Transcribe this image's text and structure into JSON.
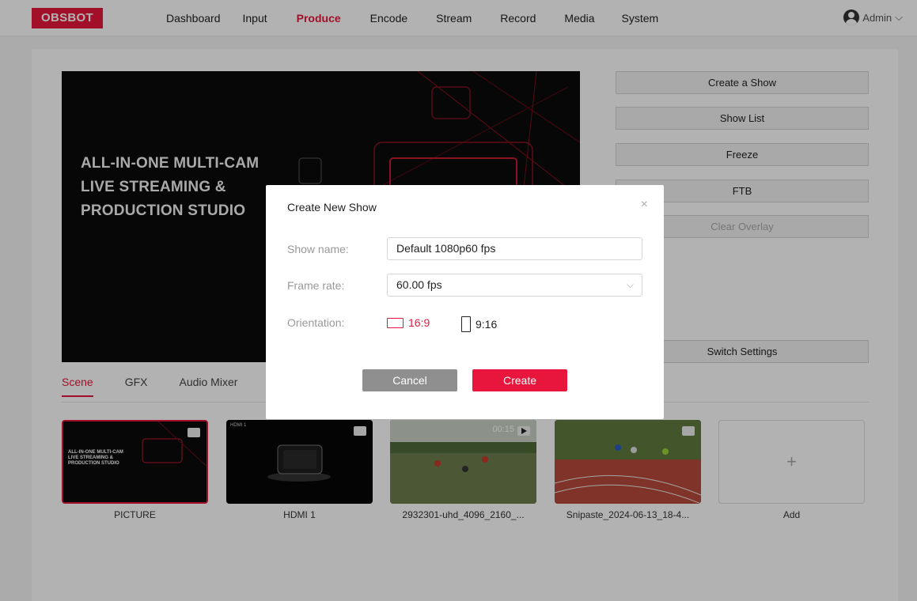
{
  "brand": {
    "logo": "OBSBOT",
    "accent": "#e8163c"
  },
  "nav": {
    "items": [
      "Dashboard",
      "Input",
      "Produce",
      "Encode",
      "Stream",
      "Record",
      "Media",
      "System"
    ],
    "active": "Produce"
  },
  "user": {
    "name": "Admin",
    "icon": "user-avatar-icon"
  },
  "preview": {
    "title_lines": [
      "ALL-IN-ONE MULTI-CAM",
      "LIVE STREAMING &",
      "PRODUCTION STUDIO"
    ]
  },
  "actions": {
    "create_show": "Create a Show",
    "show_list": "Show List",
    "freeze": "Freeze",
    "ftb": "FTB",
    "clear_overlay": "Clear Overlay",
    "switch_settings": "Switch Settings"
  },
  "tabs": {
    "items": [
      "Scene",
      "GFX",
      "Audio Mixer"
    ],
    "active": "Scene"
  },
  "scenes": [
    {
      "label": "PICTURE",
      "type": "picture",
      "selected": true
    },
    {
      "label": "HDMI 1",
      "type": "hdmi",
      "badge": "HDMI 1",
      "selected": false
    },
    {
      "label": "2932301-uhd_4096_2160_...",
      "type": "video",
      "duration": "00:15",
      "selected": false
    },
    {
      "label": "Snipaste_2024-06-13_18-4...",
      "type": "picture",
      "selected": false
    }
  ],
  "add_scene": {
    "label": "Add",
    "symbol": "+"
  },
  "modal": {
    "title": "Create New Show",
    "close_symbol": "×",
    "show_name_label": "Show name:",
    "show_name_value": "Default 1080p60 fps",
    "frame_rate_label": "Frame rate:",
    "frame_rate_value": "60.00 fps",
    "orientation_label": "Orientation:",
    "orientation_options": [
      "16:9",
      "9:16"
    ],
    "orientation_selected": "16:9",
    "cancel_label": "Cancel",
    "create_label": "Create"
  }
}
